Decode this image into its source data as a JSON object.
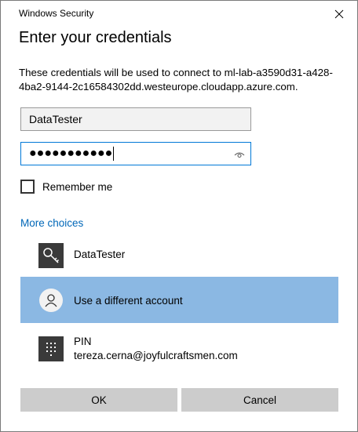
{
  "window": {
    "title": "Windows Security"
  },
  "dialog": {
    "heading": "Enter your credentials",
    "description": "These credentials will be used to connect to ml-lab-a3590d31-a428-4ba2-9144-2c16584302dd.westeurope.cloudapp.azure.com."
  },
  "form": {
    "username_value": "DataTester",
    "password_masked": "●●●●●●●●●●●",
    "remember_label": "Remember me",
    "remember_checked": false
  },
  "more_choices": {
    "label": "More choices",
    "accounts": [
      {
        "name": "DataTester",
        "icon": "key-icon"
      },
      {
        "name": "Use a different account",
        "icon": "person-icon",
        "selected": true
      },
      {
        "name": "PIN",
        "detail": "tereza.cerna@joyfulcraftsmen.com",
        "icon": "pin-keypad-icon"
      }
    ]
  },
  "buttons": {
    "ok": "OK",
    "cancel": "Cancel"
  },
  "colors": {
    "accent": "#0078d7",
    "link": "#0067b8",
    "selected_bg": "#8bb8e3",
    "button_bg": "#cccccc"
  }
}
